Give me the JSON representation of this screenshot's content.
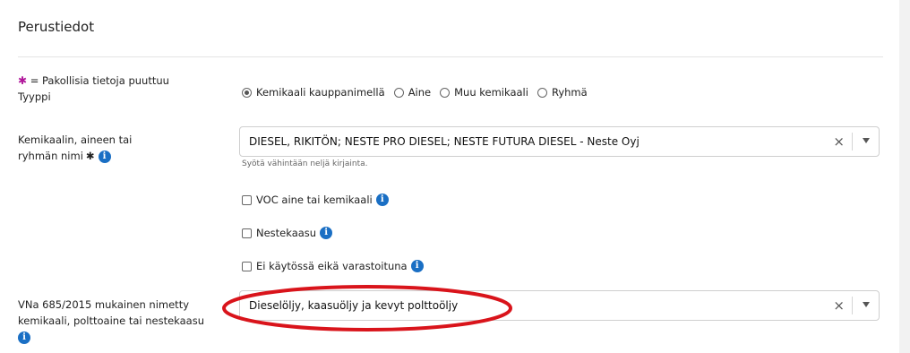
{
  "section": {
    "title": "Perustiedot"
  },
  "legend": {
    "star": "✱",
    "text": " = Pakollisia tietoja puuttuu"
  },
  "type_field": {
    "label": "Tyyppi",
    "options": [
      {
        "label": "Kemikaali kauppanimellä",
        "checked": true
      },
      {
        "label": "Aine",
        "checked": false
      },
      {
        "label": "Muu kemikaali",
        "checked": false
      },
      {
        "label": "Ryhmä",
        "checked": false
      }
    ]
  },
  "name_field": {
    "label_line1": "Kemikaalin, aineen tai",
    "label_line2": "ryhmän nimi",
    "required_star": "✱",
    "value": "DIESEL, RIKITÖN; NESTE PRO DIESEL; NESTE FUTURA DIESEL - Neste Oyj",
    "hint": "Syötä vähintään neljä kirjainta.",
    "clear": "×"
  },
  "checkboxes": [
    {
      "label": "VOC aine tai kemikaali",
      "checked": false
    },
    {
      "label": "Nestekaasu",
      "checked": false
    },
    {
      "label": "Ei käytössä eikä varastoituna",
      "checked": false
    }
  ],
  "vna_field": {
    "label_line1": "VNa 685/2015 mukainen nimetty",
    "label_line2": "kemikaali, polttoaine tai nestekaasu",
    "value": "Dieselöljy, kaasuöljy ja kevyt polttoöljy",
    "clear": "×"
  },
  "info_glyph": "i",
  "colors": {
    "required_star": "#b0169a",
    "info_icon": "#1a6fc4",
    "annotation": "#d9141b"
  }
}
